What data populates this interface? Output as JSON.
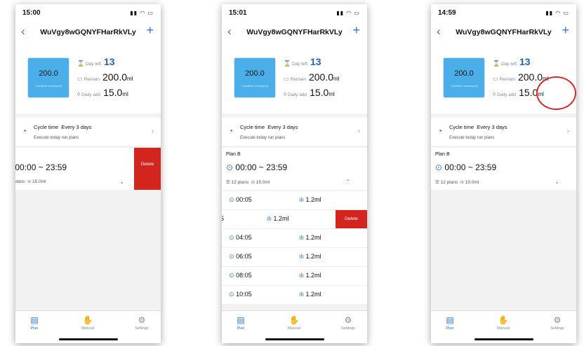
{
  "screens": [
    {
      "status_time": "15:00",
      "title": "WuVgy8wGQNYFHarRkVLy",
      "tank": {
        "value": "200.0",
        "caption": "Container volume(ml)"
      },
      "day_left": {
        "label": "Day left",
        "value": "13"
      },
      "remain": {
        "label": "Remain",
        "value": "200.0",
        "unit": "ml"
      },
      "daily_add": {
        "label": "Daily add",
        "value": "15.0",
        "unit": "ml"
      },
      "cycle": {
        "label": "Cycle time",
        "value": "Every 3 days",
        "sub": "Execute today run plans"
      },
      "plan": {
        "range": "00:00 ~ 23:59",
        "plans": "plans",
        "amount": "15.0ml",
        "delete": "Delete"
      }
    },
    {
      "status_time": "15:01",
      "title": "WuVgy8wGQNYFHarRkVLy",
      "tank": {
        "value": "200.0",
        "caption": "Container volume(ml)"
      },
      "day_left": {
        "label": "Day left",
        "value": "13"
      },
      "remain": {
        "label": "Remain",
        "value": "200.0",
        "unit": "ml"
      },
      "daily_add": {
        "label": "Daily add",
        "value": "15.0",
        "unit": "ml"
      },
      "cycle": {
        "label": "Cycle time",
        "value": "Every 3 days",
        "sub": "Execute today run plans"
      },
      "plan": {
        "name": "Plan B",
        "range": "00:00 ~ 23:59",
        "plans": "12 plans",
        "amount": "15.0ml"
      },
      "schedule": [
        {
          "time": "00:05",
          "amount": "1.2ml"
        },
        {
          "time": "5",
          "amount": "1.2ml",
          "delete": "Delete"
        },
        {
          "time": "04:05",
          "amount": "1.2ml"
        },
        {
          "time": "06:05",
          "amount": "1.2ml"
        },
        {
          "time": "08:05",
          "amount": "1.2ml"
        },
        {
          "time": "10:05",
          "amount": "1.2ml"
        }
      ]
    },
    {
      "status_time": "14:59",
      "title": "WuVgy8wGQNYFHarRkVLy",
      "tank": {
        "value": "200.0",
        "caption": "Container volume(ml)"
      },
      "day_left": {
        "label": "Day left",
        "value": "13"
      },
      "remain": {
        "label": "Remain",
        "value": "200.0",
        "unit": "ml"
      },
      "daily_add": {
        "label": "Daily add",
        "value": "15.0",
        "unit": "ml"
      },
      "cycle": {
        "label": "Cycle time",
        "value": "Every 3 days",
        "sub": "Execute today run plans"
      },
      "plan": {
        "name": "Plan B",
        "range": "00:00 ~ 23:59",
        "plans": "12 plans",
        "amount": "15.0ml"
      }
    }
  ],
  "tabs": {
    "plan": "Plan",
    "manual": "Manual",
    "settings": "Settings"
  },
  "colors": {
    "accent": "#2f76d1",
    "delete": "#d3241d",
    "tank": "#4aaee8",
    "highlight": "#d62828"
  },
  "icons": [
    "back-icon",
    "plus-icon",
    "hourglass-icon",
    "tank-icon",
    "drop-icon",
    "cycle-icon",
    "chevron-right-icon",
    "clock-icon",
    "list-icon",
    "bars-icon",
    "chevron-down-icon",
    "chevron-up-icon",
    "plan-tab-icon",
    "hand-icon",
    "gear-icon"
  ]
}
